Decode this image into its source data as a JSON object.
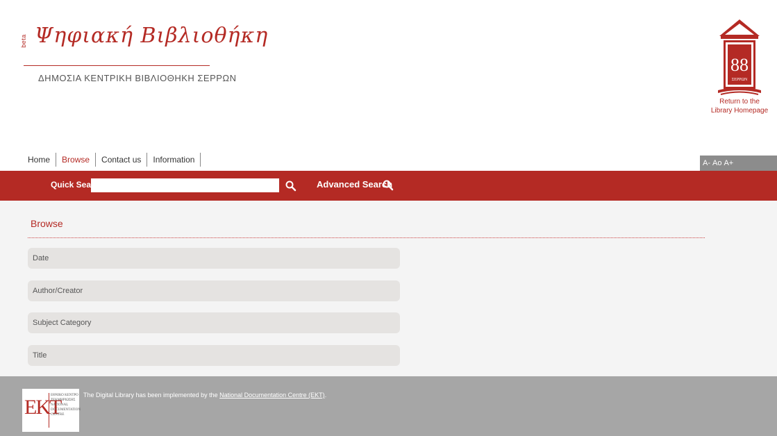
{
  "header": {
    "logo_beta": "beta",
    "logo_script": "Ψηφιακή Βιβλιοθήκη",
    "logo_subtitle": "ΔΗΜΟΣΙΑ ΚΕΝΤΡΙΚΗ ΒΙΒΛΙΟΘΗΚΗ ΣΕΡΡΩΝ",
    "return_link_line1": "Return to the",
    "return_link_line2": "Library Homepage"
  },
  "nav": {
    "items": [
      {
        "label": "Home"
      },
      {
        "label": "Browse",
        "active": true
      },
      {
        "label": "Contact us"
      },
      {
        "label": "Information"
      }
    ]
  },
  "font_size_controls": {
    "decrease": "A-",
    "normal": "Ao",
    "increase": "A+"
  },
  "search": {
    "quick_label": "Quick Search",
    "quick_value": "",
    "advanced_label": "Advanced Search"
  },
  "main": {
    "title": "Browse",
    "items": [
      {
        "label": "Date"
      },
      {
        "label": "Author/Creator"
      },
      {
        "label": "Subject Category"
      },
      {
        "label": "Title"
      }
    ]
  },
  "footer": {
    "text_prefix": "The Digital Library has been implemented by the ",
    "link_text": "National Documentation Centre (EKT)",
    "text_suffix": ".",
    "ekt_logo": {
      "line1": "ΕΘΝΙΚΟ ΚΕΝΤΡΟ",
      "line2": "ΤΕΚΜΗΡΙΩΣΗΣ",
      "line3": "NATIONAL",
      "line4": "DOCUMENTATION",
      "line5": "CENTRE"
    }
  },
  "colors": {
    "accent": "#b42a24",
    "footer": "#a6a6a6",
    "content_bg": "#f4f4f4"
  }
}
